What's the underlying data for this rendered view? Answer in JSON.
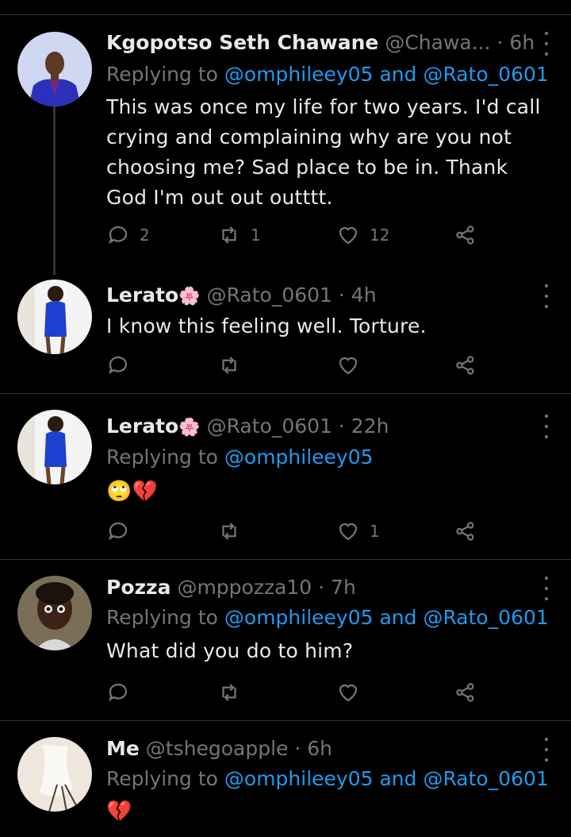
{
  "colors": {
    "accent": "#1d9bf0",
    "muted": "#71767b",
    "text": "#e7e9ea",
    "background": "#000000"
  },
  "replying_prefix": "Replying to",
  "tweets": [
    {
      "name": "Kgopotso Seth Chawane",
      "handle": "@Chawa...",
      "time": "· 6h",
      "replying_to": "@omphileey05 and @Rato_0601",
      "body": "This was once my life for two years. I'd call crying and complaining why are you not choosing me? Sad place to be in. Thank God I'm out out outttt.",
      "reply_count": "2",
      "retweet_count": "1",
      "like_count": "12"
    },
    {
      "name": "Lerato",
      "name_emoji": "🌸",
      "handle": "@Rato_0601",
      "time": "· 4h",
      "body": "I know this feeling well. Torture.",
      "reply_count": "",
      "retweet_count": "",
      "like_count": ""
    },
    {
      "name": "Lerato",
      "name_emoji": "🌸",
      "handle": "@Rato_0601",
      "time": "· 22h",
      "replying_to": "@omphileey05",
      "body": "🙄💔",
      "reply_count": "",
      "retweet_count": "",
      "like_count": "1"
    },
    {
      "name": "Pozza",
      "handle": "@mppozza10",
      "time": "· 7h",
      "replying_to": "@omphileey05 and @Rato_0601",
      "body": "What did you do to him?",
      "reply_count": "",
      "retweet_count": "",
      "like_count": ""
    },
    {
      "name": "Me",
      "handle": "@tshegoapple",
      "time": "· 6h",
      "replying_to": "@omphileey05 and @Rato_0601",
      "body": "💔"
    }
  ]
}
